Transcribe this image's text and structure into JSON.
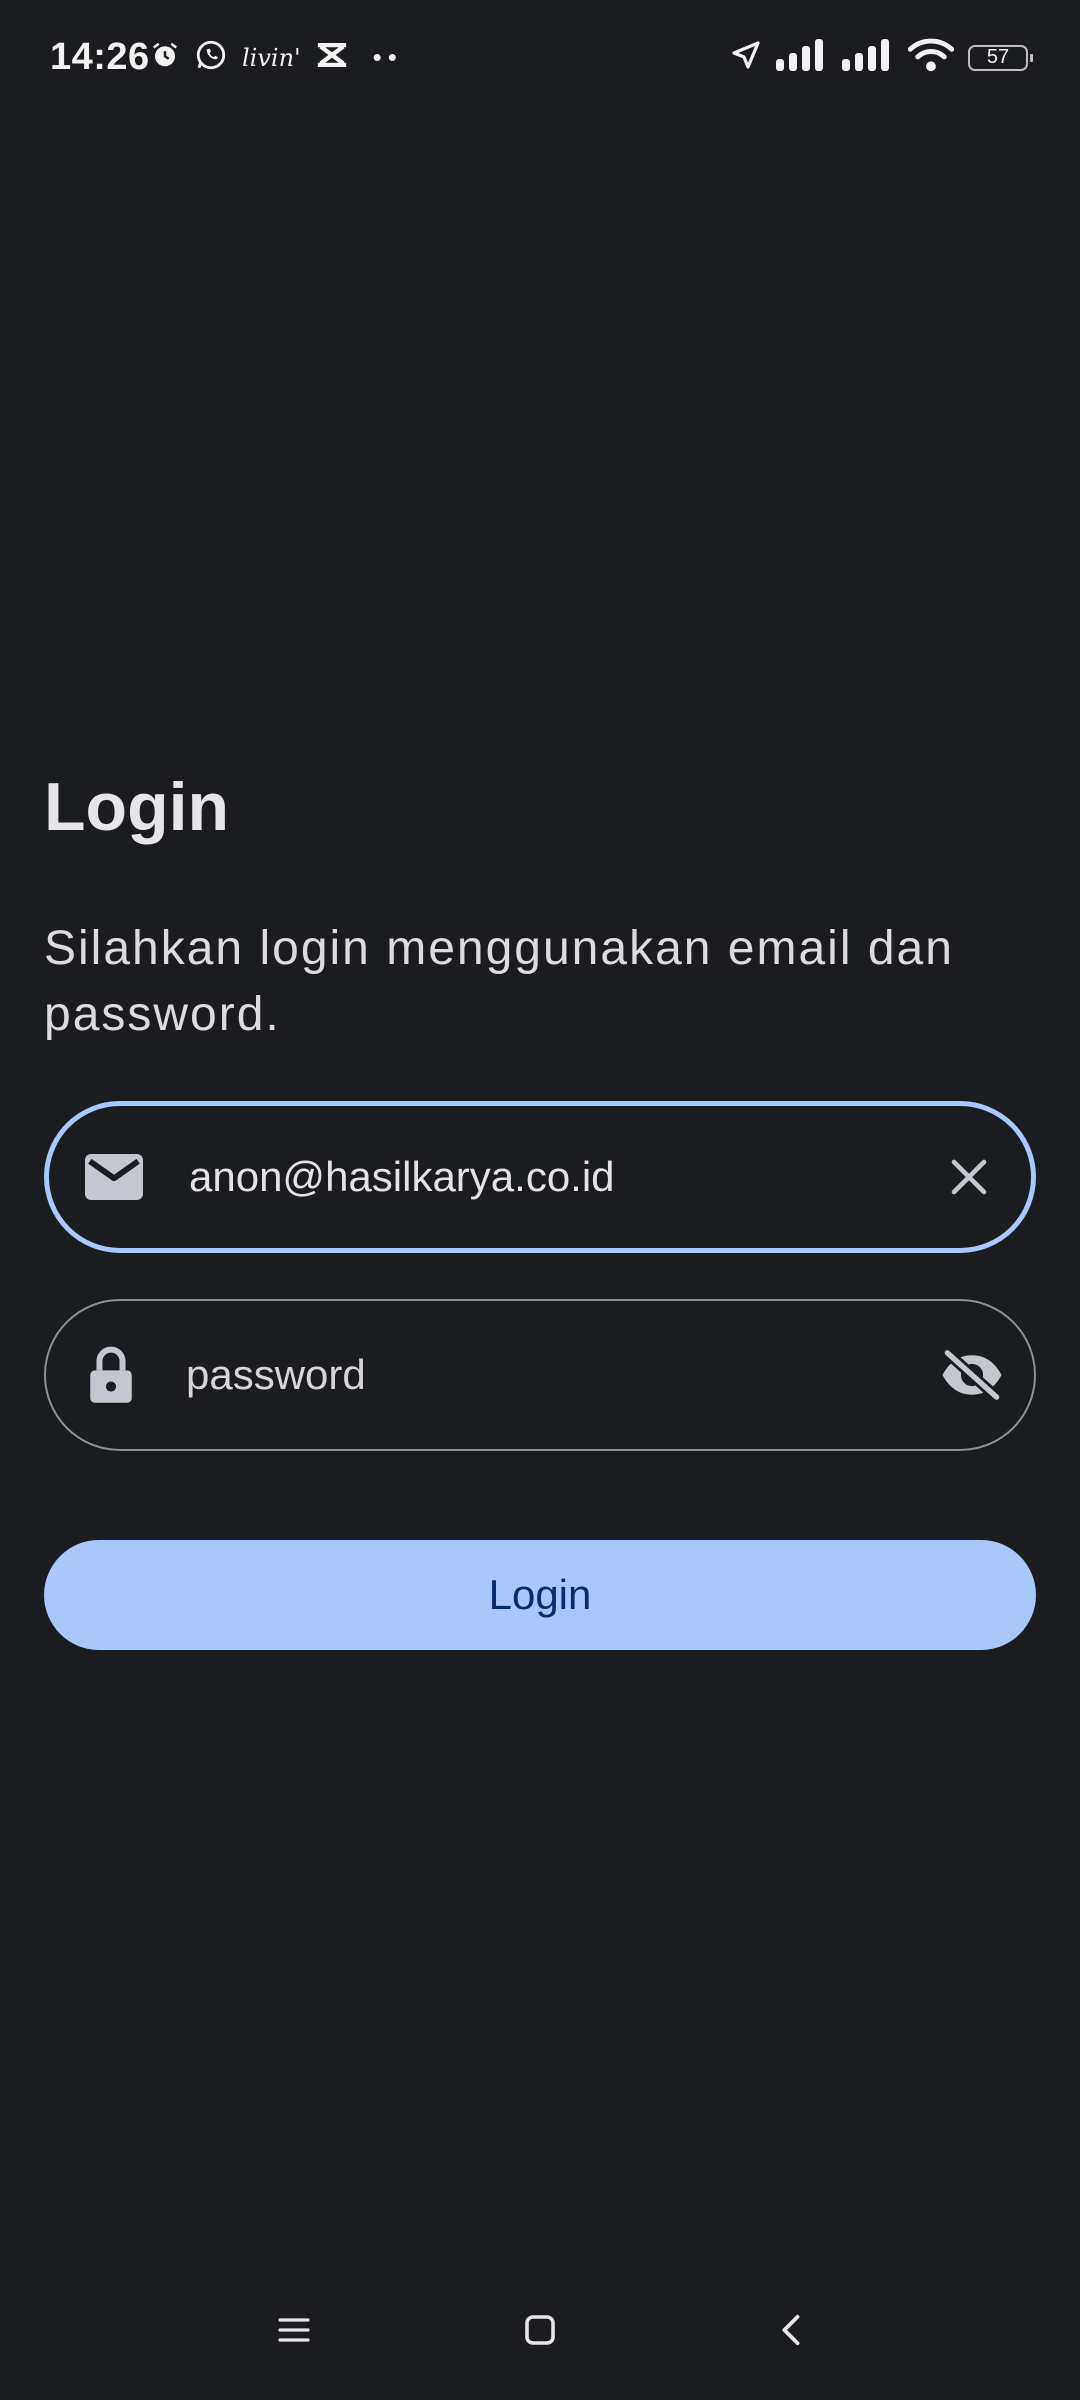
{
  "status_bar": {
    "time": "14:26",
    "left_icons": [
      "alarm-icon",
      "whatsapp-icon",
      "livin-app-icon",
      "capcut-icon",
      "more-dots-icon"
    ],
    "livin_label": "livin'",
    "right_icons": [
      "location-arrow-icon",
      "signal-1-icon",
      "signal-2-icon",
      "wifi-icon",
      "battery-icon"
    ],
    "battery_level": "57"
  },
  "login": {
    "title": "Login",
    "subtitle": "Silahkan login menggunakan email dan password.",
    "email": {
      "value": "anon@hasilkarya.co.id",
      "leading_icon": "email-icon",
      "trailing_icon": "clear-icon"
    },
    "password": {
      "value": "",
      "placeholder": "password",
      "leading_icon": "lock-icon",
      "trailing_icon": "visibility-off-icon"
    },
    "button_label": "Login"
  },
  "nav_bar": {
    "items": [
      "recents-icon",
      "home-icon",
      "back-icon"
    ]
  },
  "colors": {
    "background": "#1a1c1f",
    "accent": "#a8c7fa",
    "button_text": "#062e6f",
    "outline": "#8e9099"
  }
}
